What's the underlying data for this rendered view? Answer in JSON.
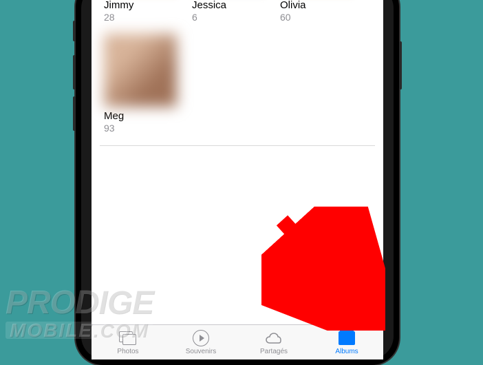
{
  "people": [
    {
      "name": "Jimmy",
      "count": "28"
    },
    {
      "name": "Jessica",
      "count": "6"
    },
    {
      "name": "Olivia",
      "count": "60"
    },
    {
      "name": "Meg",
      "count": "93"
    }
  ],
  "tabs": {
    "photos": {
      "label": "Photos"
    },
    "souvenirs": {
      "label": "Souvenirs"
    },
    "partages": {
      "label": "Partagés"
    },
    "albums": {
      "label": "Albums"
    }
  },
  "watermark": {
    "line1": "PRODIGE",
    "line2": "MOBILE.COM"
  },
  "colors": {
    "accent": "#007aff",
    "inactive": "#8e8e93",
    "background": "#3b9b9b",
    "arrow": "#ff0000"
  }
}
